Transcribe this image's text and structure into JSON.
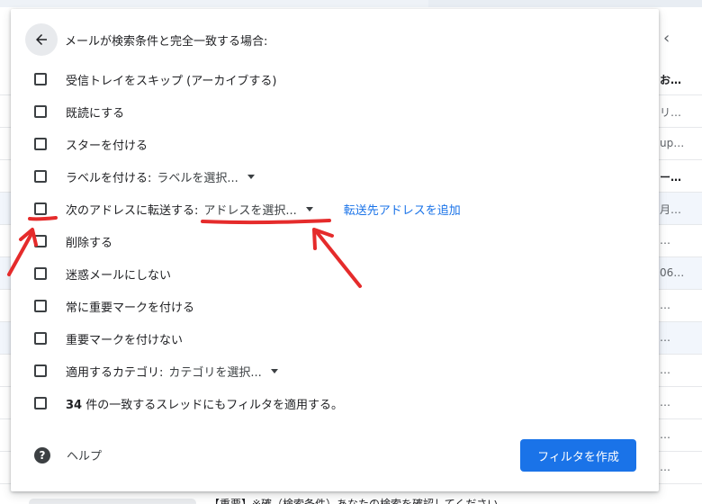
{
  "background": {
    "snippets": [
      "お…",
      "リ…",
      "up…",
      "ー…",
      "月…",
      "…",
      "06…",
      "…",
      "…",
      "…",
      "…",
      "…",
      "…"
    ],
    "bottom_text": "【重要】※確（検索条件）あなたの検索を確認してください"
  },
  "dialog": {
    "title": "メールが検索条件と完全一致する場合:",
    "options": [
      {
        "label": "受信トレイをスキップ (アーカイブする)"
      },
      {
        "label": "既読にする"
      },
      {
        "label": "スターを付ける"
      },
      {
        "label": "ラベルを付ける:",
        "dropdown": "ラベルを選択..."
      },
      {
        "label": "次のアドレスに転送する:",
        "dropdown": "アドレスを選択...",
        "link": "転送先アドレスを追加"
      },
      {
        "label": "削除する"
      },
      {
        "label": "迷惑メールにしない"
      },
      {
        "label": "常に重要マークを付ける"
      },
      {
        "label": "重要マークを付けない"
      },
      {
        "label": "適用するカテゴリ:",
        "dropdown": "カテゴリを選択..."
      },
      {
        "label_bold": "34",
        "label": " 件の一致するスレッドにもフィルタを適用する。"
      }
    ],
    "help_label": "ヘルプ",
    "help_icon": "?",
    "create_button": "フィルタを作成"
  },
  "colors": {
    "primary": "#1a73e8",
    "annotation": "#e52b2b"
  }
}
